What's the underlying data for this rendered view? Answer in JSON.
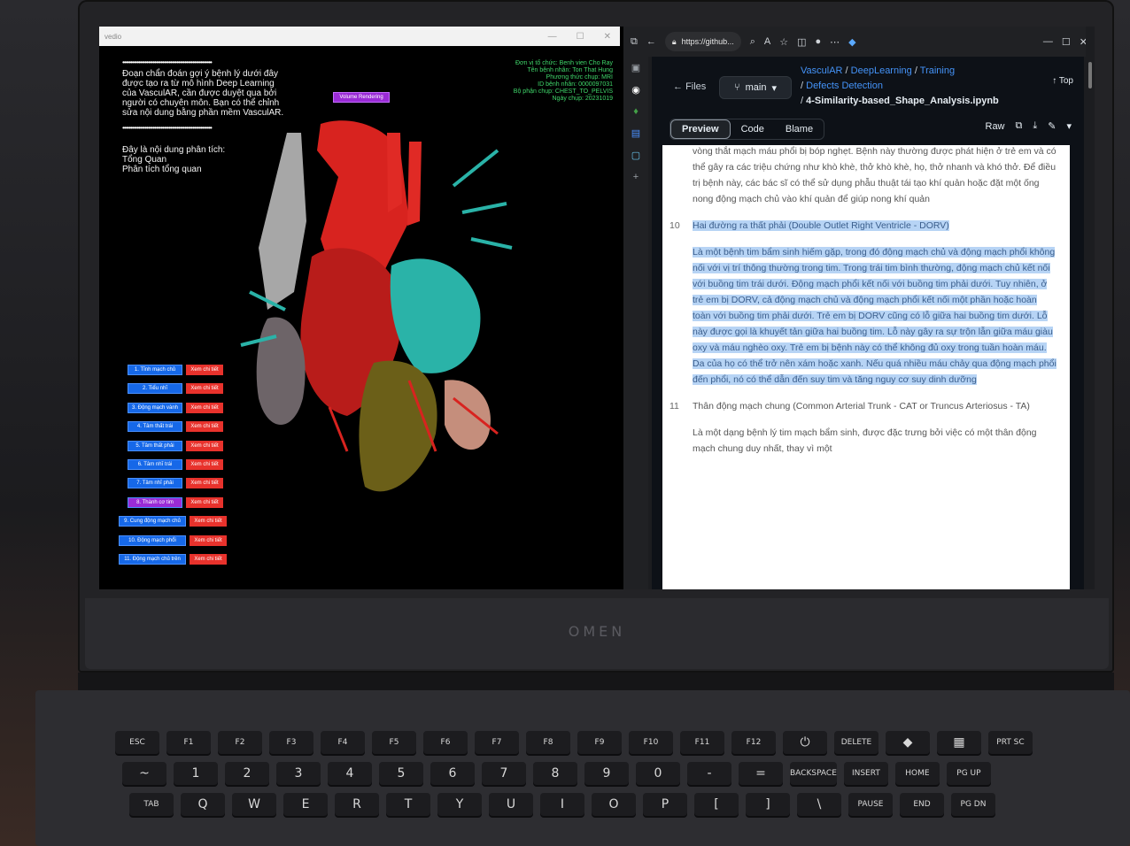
{
  "app": {
    "title": "vedio",
    "window_controls": [
      "—",
      "☐",
      "✕"
    ],
    "dots": "••••••••••••••••••••••••••••••••••••••••••••••••••••••••",
    "intro": [
      "Đoạn chẩn đoán gợi ý bệnh lý dưới đây",
      "được tạo ra từ mô hình Deep Learning",
      "của VasculAR, cần được duyệt qua bởi",
      "người có chuyên môn. Bạn có thể chỉnh",
      "sửa nội dung bằng phần mềm VasculAR."
    ],
    "analysis": [
      "Đây là nội dung phân tích:",
      "Tổng Quan",
      "Phân tích tổng quan"
    ],
    "patient_info": [
      "Đơn vị tổ chức: Benh vien Cho Ray",
      "Tên bệnh nhân: Ton That Hung",
      "Phương thức chụp: MRI",
      "ID bệnh nhân: 0000097031",
      "Bộ phận chụp: CHEST_TO_PELVIS",
      "Ngày chụp: 20231019"
    ],
    "volume_button": "Volume Rendering",
    "detail_label": "Xem chi tiết",
    "structures": [
      {
        "label": "1. Tĩnh mạch chủ",
        "color": "#1668e8"
      },
      {
        "label": "2. Tiểu nhĩ",
        "color": "#1668e8"
      },
      {
        "label": "3. Động mạch vành",
        "color": "#1668e8"
      },
      {
        "label": "4. Tâm thất trái",
        "color": "#1668e8"
      },
      {
        "label": "5. Tâm thất phải",
        "color": "#1668e8"
      },
      {
        "label": "6. Tâm nhĩ trái",
        "color": "#1668e8"
      },
      {
        "label": "7. Tâm nhĩ phải",
        "color": "#1668e8"
      },
      {
        "label": "8. Thành cơ tim",
        "color": "#9a2bd6"
      },
      {
        "label": "9. Cung động mạch chủ",
        "color": "#1668e8"
      },
      {
        "label": "10. Động mạch phổi",
        "color": "#1668e8"
      },
      {
        "label": "11. Động mạch chủ trên",
        "color": "#1668e8"
      }
    ]
  },
  "browser": {
    "url": "https://github...",
    "breadcrumb": {
      "repo": "VasculAR",
      "p1": "DeepLearning",
      "p2": "Training",
      "p3": "Defects Detection",
      "file": "4-Similarity-based_Shape_Analysis.ipynb"
    },
    "files_label": "Files",
    "branch": "main",
    "top_label": "Top",
    "tabs": [
      "Preview",
      "Code",
      "Blame"
    ],
    "raw_label": "Raw",
    "content": {
      "prev_para": "vòng thắt mạch máu phổi bị bóp nghẹt. Bệnh này thường được phát hiện ở trẻ em và có thể gây ra các triệu chứng như khò khè, thở khò khè, họ, thở nhanh và khó thở. Để điều trị bệnh này, các bác sĩ có thể sử dụng phẫu thuật tái tạo khí quản hoặc đặt một ống nong động mạch chủ vào khí quản để giúp nong khí quản",
      "item10_num": "10",
      "item10_title": "Hai đường ra thất phải (Double Outlet Right Ventricle - DORV)",
      "item10_body": "Là một bệnh tim bẩm sinh hiếm gặp, trong đó động mạch chủ và động mạch phổi không nối với vị trí thông thường trong tim. Trong trái tim bình thường, động mạch chủ kết nối với buồng tim trái dưới. Động mạch phổi kết nối với buồng tim phải dưới. Tuy nhiên, ở trẻ em bị DORV, cả động mạch chủ và động mạch phổi kết nối một phần hoặc hoàn toàn với buồng tim phải dưới. Trẻ em bị DORV cũng có lỗ giữa hai buồng tim dưới. Lỗ này được gọi là khuyết tản giữa hai buồng tim. Lỗ này gây ra sự trộn lẫn giữa máu giàu oxy và máu nghèo oxy. Trẻ em bị bệnh này có thể không đủ oxy trong tuần hoàn máu. Da của họ có thể trở nên xám hoặc xanh. Nếu quá nhiều máu chảy qua động mạch phổi đến phổi, nó có thể dẫn đến suy tim và tăng nguy cơ suy dinh dưỡng",
      "item11_num": "11",
      "item11_title": "Thân động mạch chung (Common Arterial Trunk - CAT or Truncus Arteriosus - TA)",
      "item11_body": "Là một dạng bệnh lý tim mạch bẩm sinh, được đặc trưng bởi việc có một thân động mạch chung duy nhất, thay vì một"
    }
  },
  "laptop": {
    "brand": "OMEN"
  },
  "keyboard": {
    "row1": [
      "ESC",
      "F1",
      "F2",
      "F3",
      "F4",
      "F5",
      "F6",
      "F7",
      "F8",
      "F9",
      "F10",
      "F11",
      "F12",
      "⏻",
      "DELETE",
      "◆",
      "▦",
      "PRT SC"
    ],
    "row2": [
      "~",
      "1",
      "2",
      "3",
      "4",
      "5",
      "6",
      "7",
      "8",
      "9",
      "0",
      "-",
      "=",
      "BACKSPACE",
      "INSERT",
      "HOME",
      "PG UP"
    ],
    "row3": [
      "TAB",
      "Q",
      "W",
      "E",
      "R",
      "T",
      "Y",
      "U",
      "I",
      "O",
      "P",
      "[",
      "]",
      "\\",
      "PAUSE",
      "END",
      "PG DN"
    ]
  }
}
